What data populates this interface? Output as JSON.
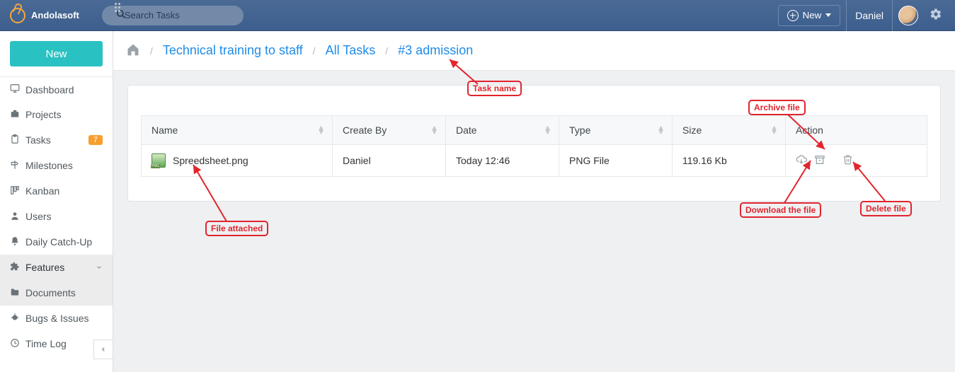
{
  "topbar": {
    "brand": "Andolasoft",
    "search_placeholder": "Search Tasks",
    "new_label": "New",
    "user": "Daniel"
  },
  "sidebar": {
    "new_label": "New",
    "items": [
      {
        "label": "Dashboard"
      },
      {
        "label": "Projects"
      },
      {
        "label": "Tasks",
        "badge": "7"
      },
      {
        "label": "Milestones"
      },
      {
        "label": "Kanban"
      },
      {
        "label": "Users"
      },
      {
        "label": "Daily Catch-Up"
      },
      {
        "label": "Features"
      },
      {
        "label": "Documents"
      },
      {
        "label": "Bugs & Issues"
      },
      {
        "label": "Time Log"
      }
    ]
  },
  "crumbs": {
    "project": "Technical training to staff",
    "section": "All Tasks",
    "task": "#3 admission"
  },
  "table": {
    "headers": {
      "name": "Name",
      "createby": "Create By",
      "date": "Date",
      "type": "Type",
      "size": "Size",
      "action": "Action"
    },
    "row": {
      "name": "Spreedsheet.png",
      "createby": "Daniel",
      "date": "Today 12:46",
      "type": "PNG File",
      "size": "119.16 Kb"
    }
  },
  "annotations": {
    "task_name": "Task name",
    "archive": "Archive file",
    "download": "Download the file",
    "delete": "Delete file",
    "attached": "File attached"
  }
}
